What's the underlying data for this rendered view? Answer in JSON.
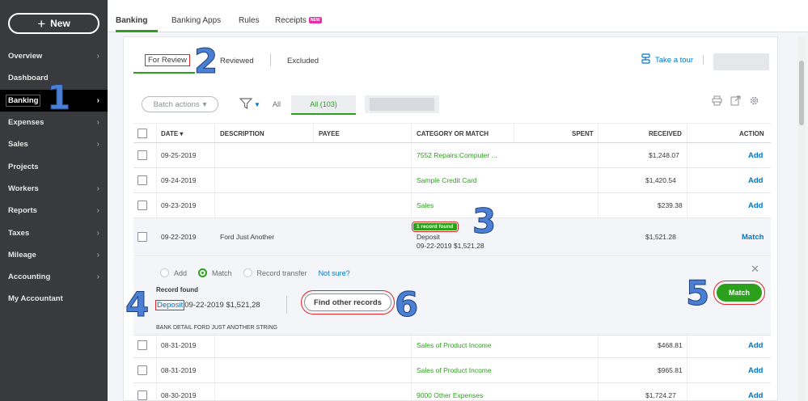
{
  "sidebar": {
    "new_label": "New",
    "items": [
      {
        "label": "Overview",
        "chevron": true
      },
      {
        "label": "Dashboard",
        "chevron": false
      },
      {
        "label": "Banking",
        "chevron": true,
        "active": true
      },
      {
        "label": "Expenses",
        "chevron": true
      },
      {
        "label": "Sales",
        "chevron": true
      },
      {
        "label": "Projects",
        "chevron": false
      },
      {
        "label": "Workers",
        "chevron": true
      },
      {
        "label": "Reports",
        "chevron": true
      },
      {
        "label": "Taxes",
        "chevron": true
      },
      {
        "label": "Mileage",
        "chevron": true
      },
      {
        "label": "Accounting",
        "chevron": true
      },
      {
        "label": "My Accountant",
        "chevron": false
      }
    ]
  },
  "top_tabs": {
    "banking": "Banking",
    "banking_apps": "Banking Apps",
    "rules": "Rules",
    "receipts": "Receipts",
    "new_badge": "NEW"
  },
  "sub_tabs": {
    "for_review": "For Review",
    "reviewed": "Reviewed",
    "excluded": "Excluded",
    "take_tour": "Take a tour"
  },
  "toolbar": {
    "batch_actions": "Batch actions",
    "all_label": "All",
    "all_pill": "All (103)"
  },
  "table": {
    "headers": {
      "date": "DATE",
      "description": "DESCRIPTION",
      "payee": "PAYEE",
      "category": "CATEGORY OR MATCH",
      "spent": "SPENT",
      "received": "RECEIVED",
      "action": "ACTION"
    },
    "rows_top": [
      {
        "date": "09-25-2019",
        "category": "7552 Repairs:Computer ...",
        "received": "$1,248.07",
        "action": "Add"
      },
      {
        "date": "09-24-2019",
        "category": "Sample Credit Card",
        "received": "$1,420.54",
        "action": "Add"
      },
      {
        "date": "09-23-2019",
        "category": "Sales",
        "received": "$239.38",
        "action": "Add"
      }
    ],
    "selected_row": {
      "date": "09-22-2019",
      "description": "Ford Just Another",
      "badge": "1 record found",
      "match_type": "Deposit",
      "match_detail": "09-22-2019 $1,521,28",
      "received": "$1,521.28",
      "action": "Match"
    },
    "rows_bottom": [
      {
        "date": "08-31-2019",
        "category": "Sales of Product Income",
        "received": "$468.81",
        "action": "Add"
      },
      {
        "date": "08-31-2019",
        "category": "Sales of Product Income",
        "received": "$965.81",
        "action": "Add"
      },
      {
        "date": "08-30-2019",
        "category": "9000 Other Expenses",
        "received": "$1,724.27",
        "action": "Add"
      }
    ]
  },
  "detail": {
    "radio_add": "Add",
    "radio_match": "Match",
    "radio_transfer": "Record transfer",
    "not_sure": "Not sure?",
    "record_found": "Record found",
    "deposit_link": "Deposit",
    "deposit_detail": "09-22-2019 $1,521,28",
    "find_other": "Find other records",
    "match_button": "Match",
    "bank_detail": "BANK DETAIL FORD JUST ANOTHER STRING"
  },
  "annotations": [
    "1",
    "2",
    "3",
    "4",
    "5",
    "6"
  ],
  "colors": {
    "sidebar_bg": "#393a3d",
    "accent_green": "#2ca01c",
    "link_blue": "#0077c5",
    "highlight_red": "#e0262b",
    "annotation_blue": "#4a7fd4"
  }
}
